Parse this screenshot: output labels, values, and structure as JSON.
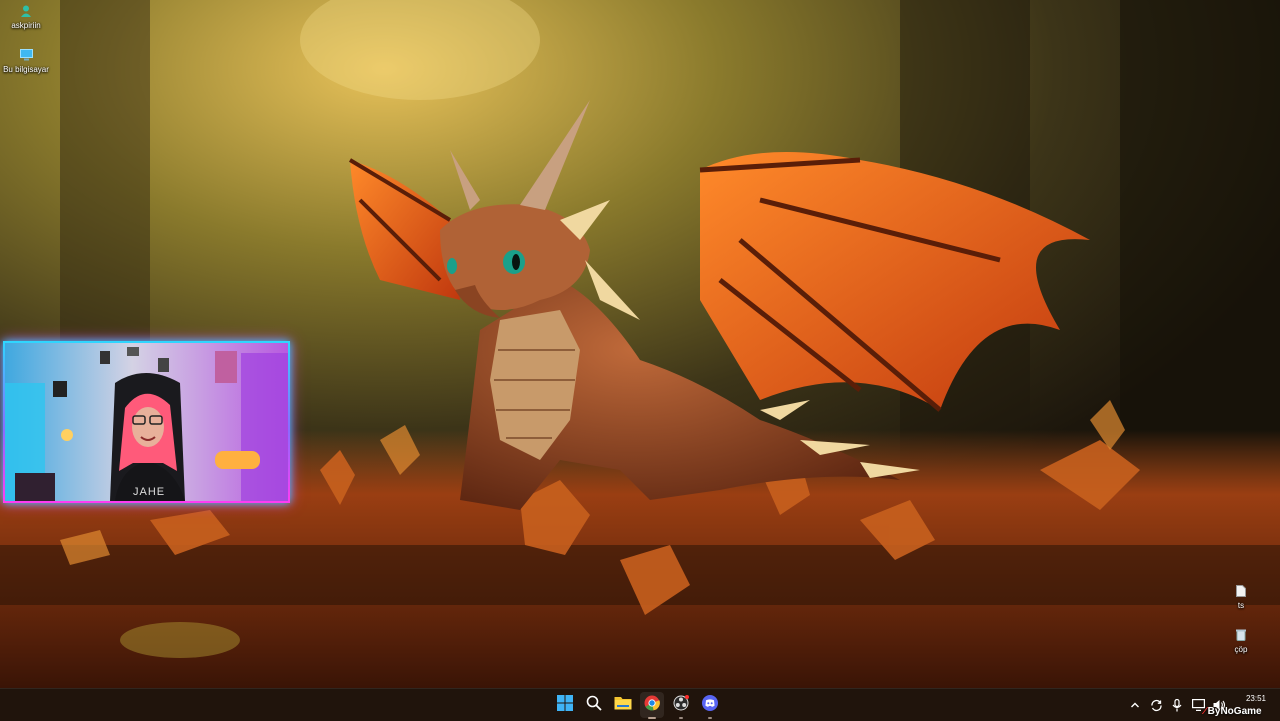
{
  "desktop": {
    "left_icons": [
      {
        "label": "askpiriin",
        "icon": "user-folder-icon"
      },
      {
        "label": "Bu bilgisayar",
        "icon": "computer-icon"
      }
    ],
    "right_icons": [
      {
        "label": "ts",
        "icon": "file-icon"
      },
      {
        "label": "çöp",
        "icon": "recycle-bin-icon"
      }
    ],
    "wallpaper": "autumn dragon wallpaper"
  },
  "webcam": {
    "border_colors": [
      "#2fd6ff",
      "#ff3cf2"
    ],
    "shirt_text": "JAHE"
  },
  "taskbar": {
    "apps": [
      {
        "name": "start",
        "icon": "windows-start-icon"
      },
      {
        "name": "search",
        "icon": "search-icon"
      },
      {
        "name": "file-explorer",
        "icon": "folder-icon"
      },
      {
        "name": "chrome",
        "icon": "chrome-icon"
      },
      {
        "name": "obs",
        "icon": "obs-icon"
      },
      {
        "name": "discord",
        "icon": "discord-icon"
      }
    ],
    "tray": [
      "chevron-up-icon",
      "sync-icon",
      "microphone-icon",
      "display-icon",
      "volume-icon"
    ],
    "clock": {
      "time": "23:51",
      "date": ""
    },
    "watermark": "ByNoGame"
  },
  "colors": {
    "taskbar_bg": "#20140c",
    "accent_cyan": "#2fd6ff",
    "accent_pink": "#ff3cf2"
  }
}
